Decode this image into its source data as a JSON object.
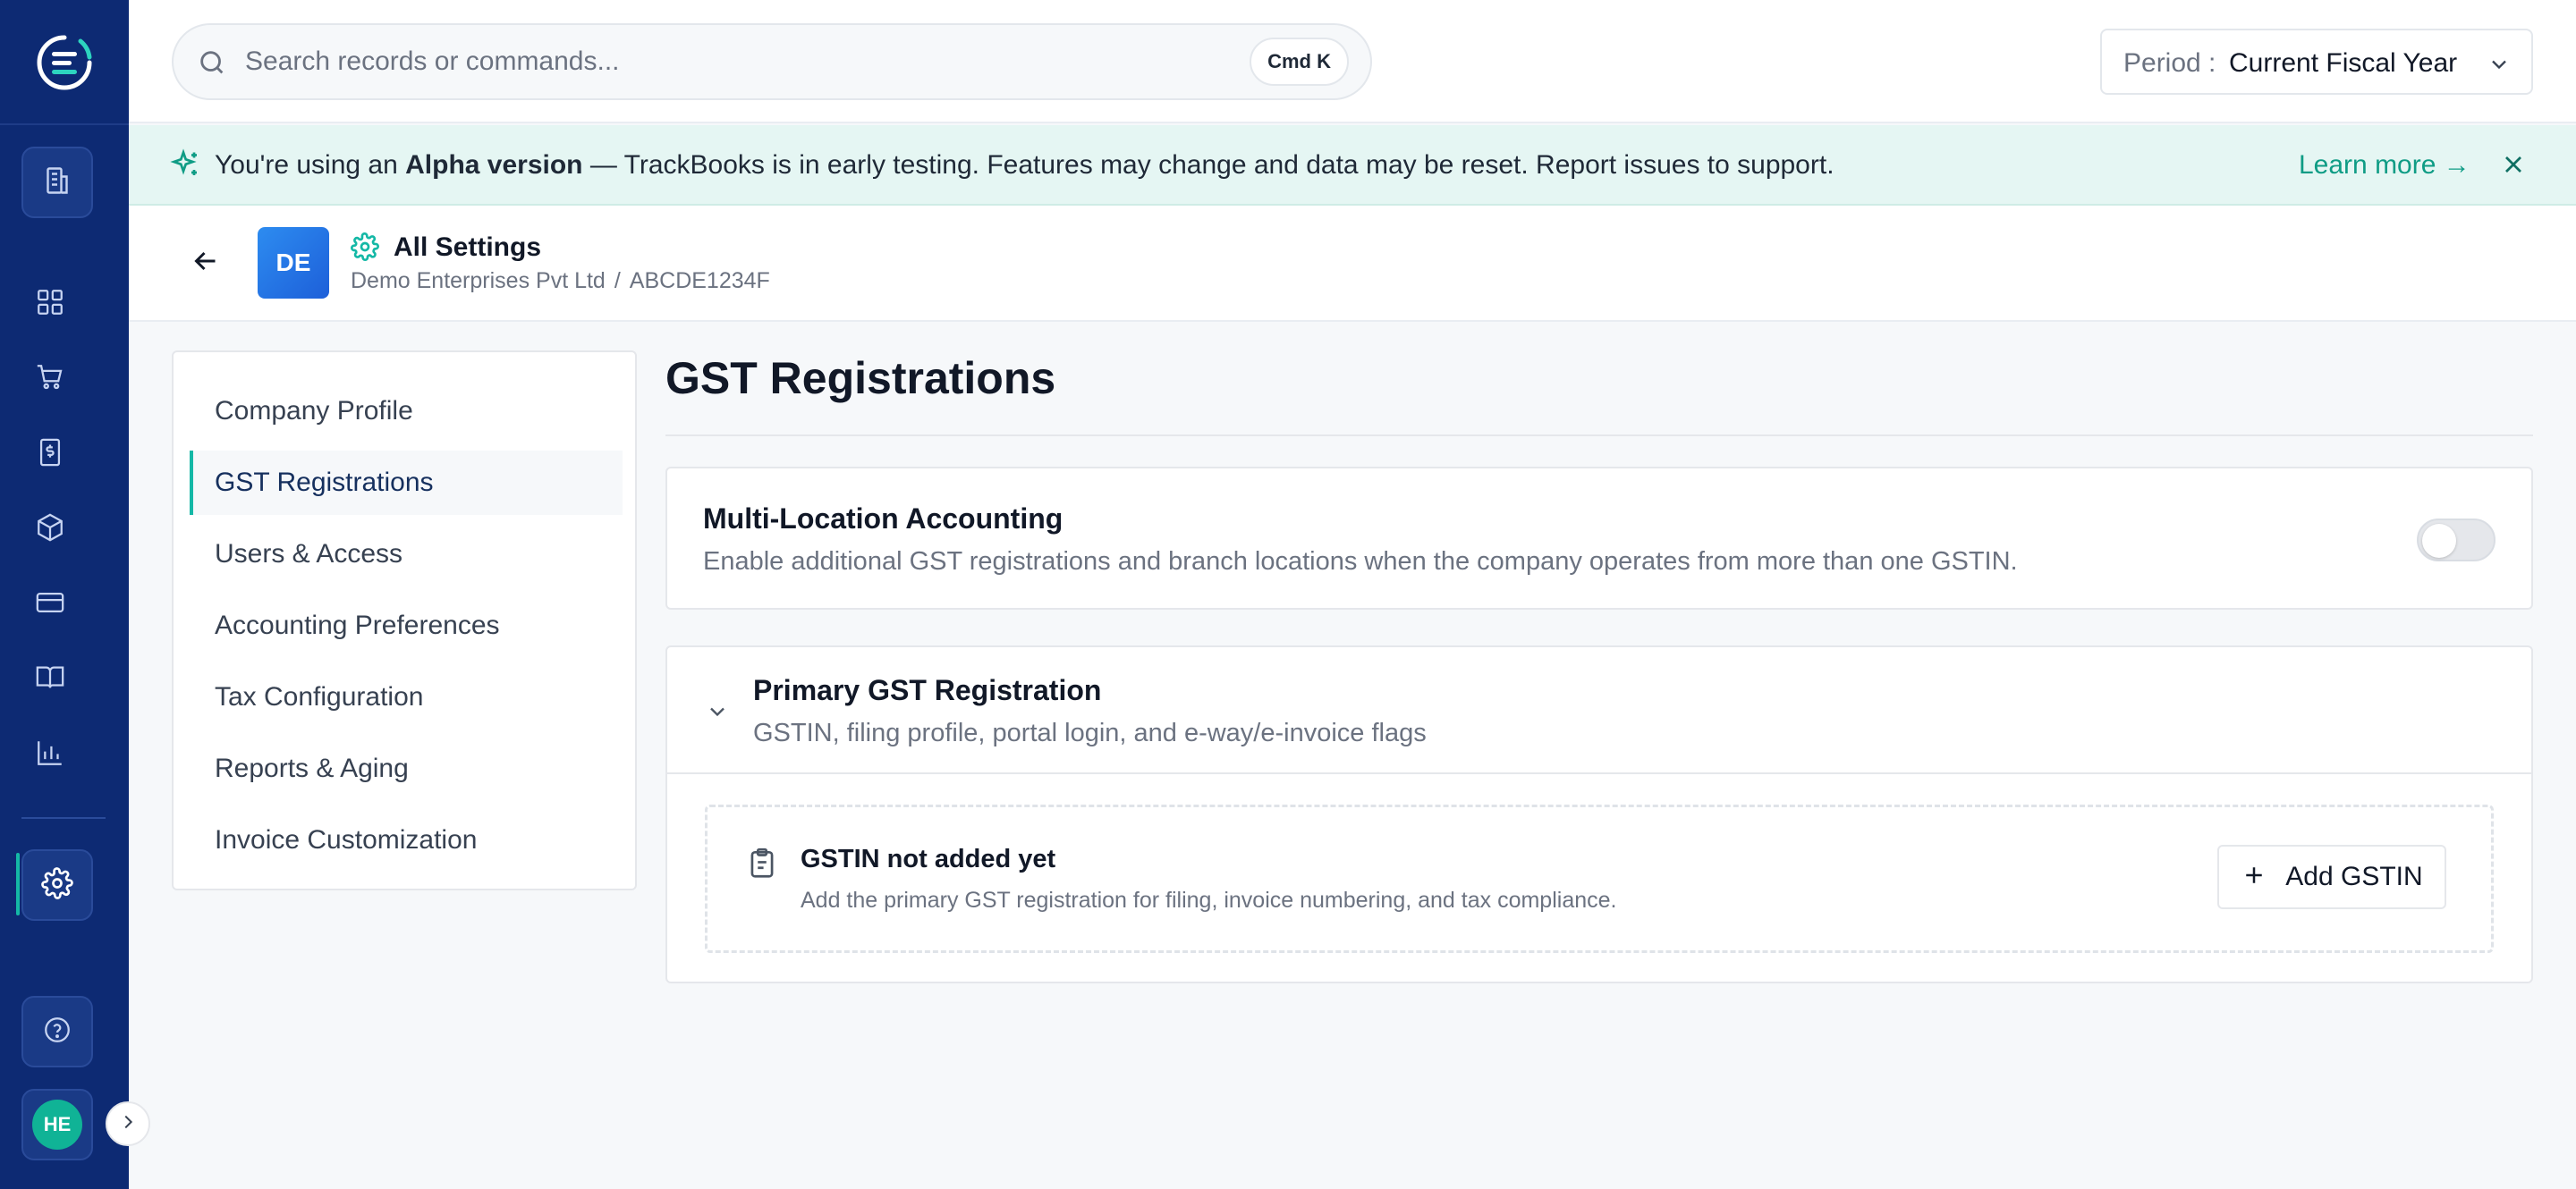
{
  "rail": {
    "logo": "trackbooks-logo",
    "items": [
      {
        "name": "building-icon",
        "active": false
      },
      {
        "name": "dashboard-grid-icon"
      },
      {
        "name": "cart-icon"
      },
      {
        "name": "invoice-dollar-icon"
      },
      {
        "name": "box-icon"
      },
      {
        "name": "credit-card-icon"
      },
      {
        "name": "book-icon"
      },
      {
        "name": "bar-chart-icon"
      },
      {
        "name": "gear-icon",
        "active": true
      },
      {
        "name": "help-icon"
      }
    ],
    "user_initials": "HE"
  },
  "topbar": {
    "search_placeholder": "Search records or commands...",
    "shortcut": "Cmd K",
    "period_label": "Period :",
    "period_value": "Current Fiscal Year"
  },
  "banner": {
    "prefix": "You're using an ",
    "highlight": "Alpha version",
    "suffix": " — TrackBooks is in early testing. Features may change and data may be reset. Report issues to support.",
    "link": "Learn more →"
  },
  "settings_header": {
    "company_badge": "DE",
    "title": "All Settings",
    "company_name": "Demo Enterprises Pvt Ltd",
    "separator": "/",
    "pan": "ABCDE1234F"
  },
  "settings_nav": {
    "items": [
      {
        "label": "Company Profile",
        "active": false
      },
      {
        "label": "GST Registrations",
        "active": true
      },
      {
        "label": "Users & Access",
        "active": false
      },
      {
        "label": "Accounting Preferences",
        "active": false
      },
      {
        "label": "Tax Configuration",
        "active": false
      },
      {
        "label": "Reports & Aging",
        "active": false
      },
      {
        "label": "Invoice Customization",
        "active": false
      }
    ]
  },
  "main": {
    "title": "GST Registrations",
    "multi_location": {
      "title": "Multi-Location Accounting",
      "description": "Enable additional GST registrations and branch locations when the company operates from more than one GSTIN.",
      "enabled": false
    },
    "primary": {
      "title": "Primary GST Registration",
      "description": "GSTIN, filing profile, portal login, and e-way/e-invoice flags",
      "empty_title": "GSTIN not added yet",
      "empty_description": "Add the primary GST registration for filing, invoice numbering, and tax compliance.",
      "add_button": "Add GSTIN"
    }
  },
  "colors": {
    "rail": "#0d2a73",
    "accent": "#14b8a6",
    "banner_bg": "#e5f6f3",
    "link": "#0f9c85"
  }
}
